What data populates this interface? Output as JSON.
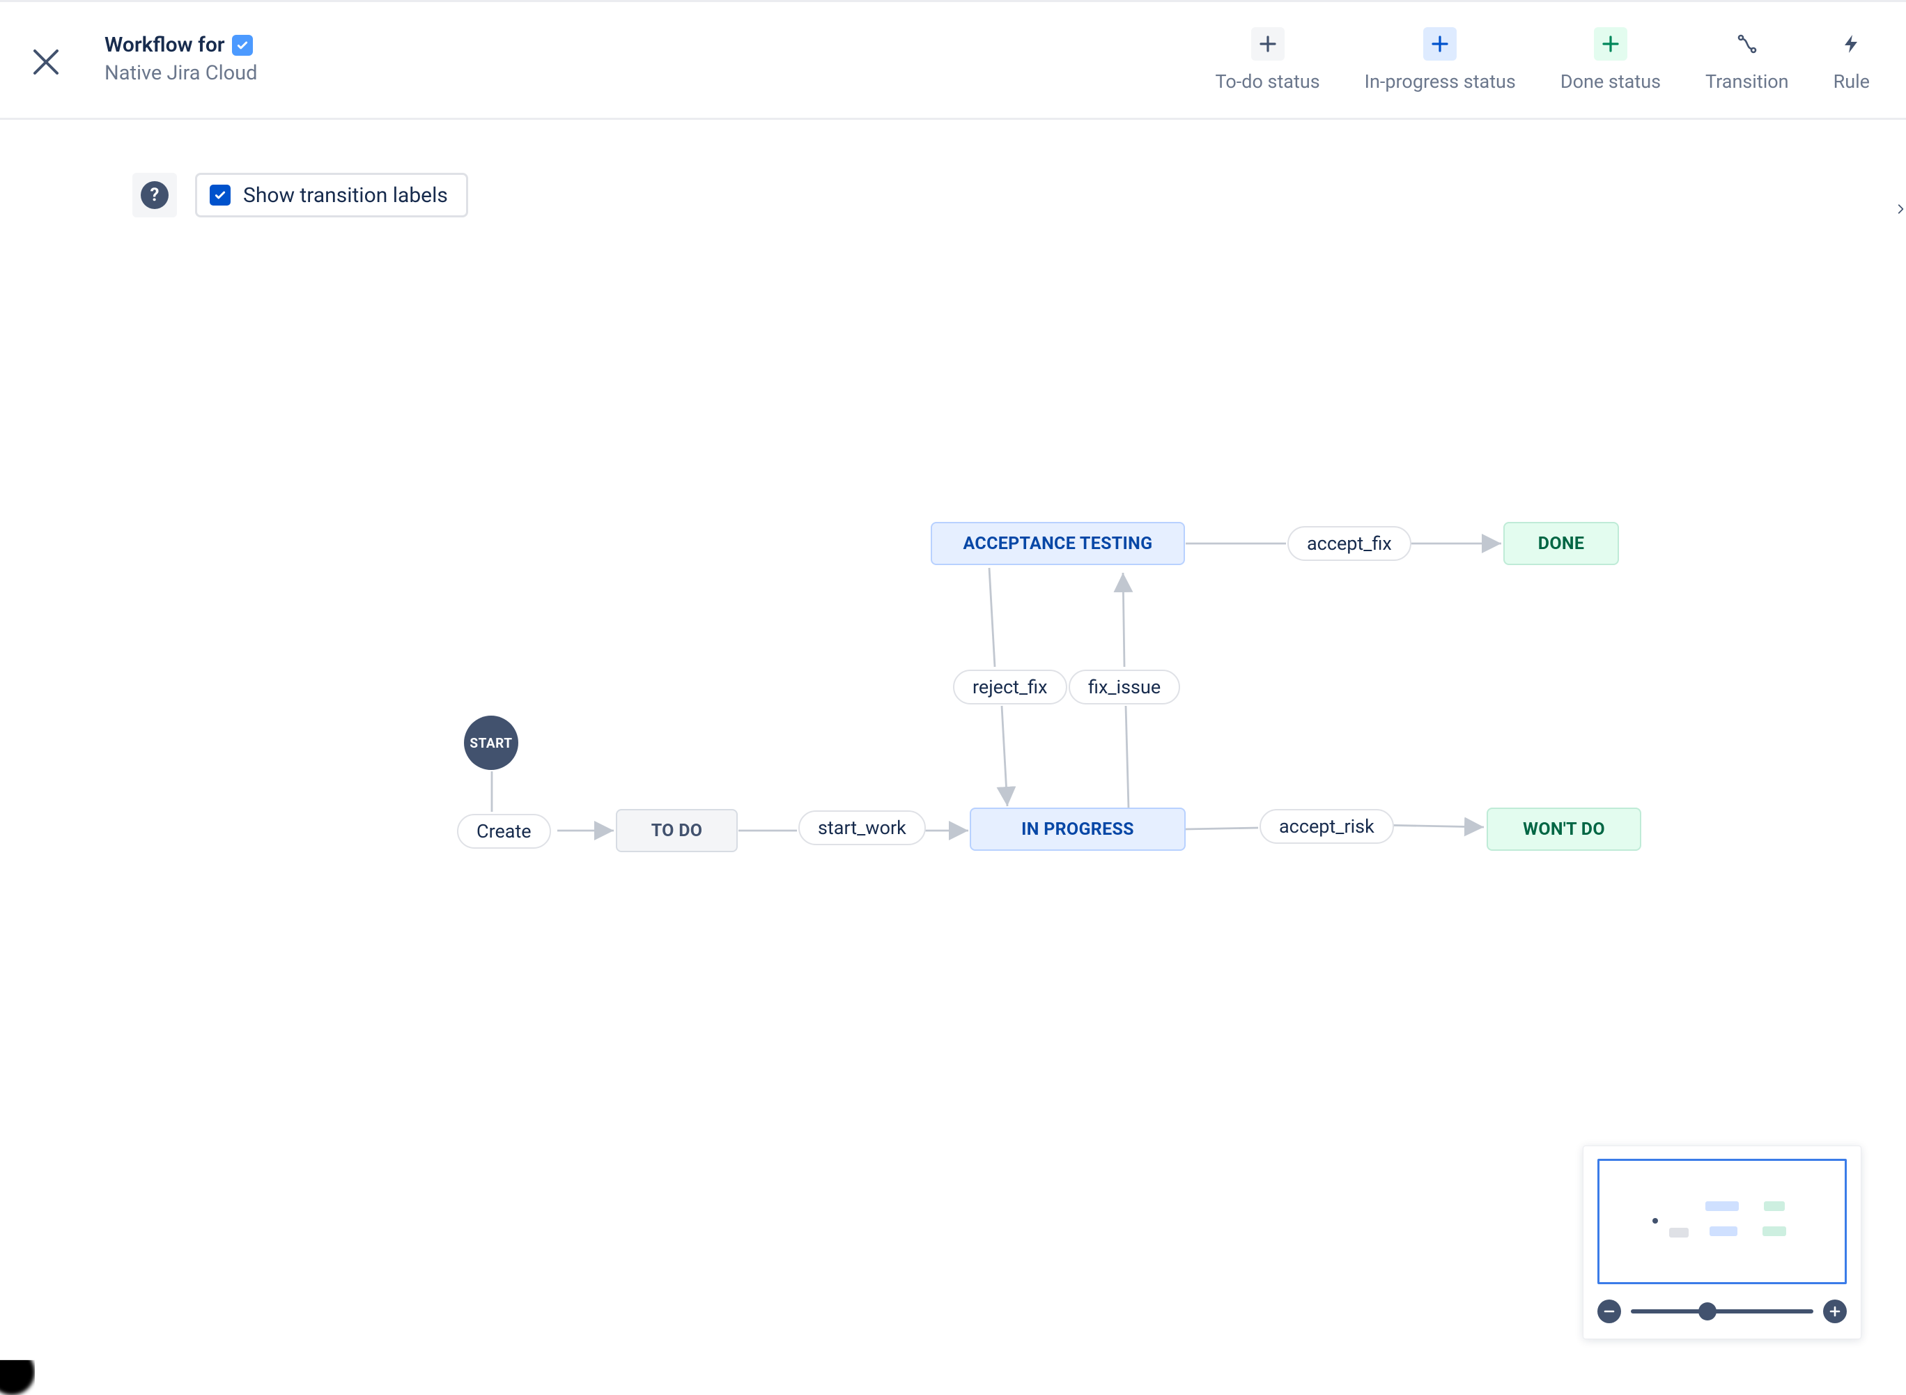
{
  "header": {
    "title": "Workflow for",
    "badge_icon": "check-icon",
    "subtitle": "Native Jira Cloud",
    "toolbar": {
      "todo": {
        "label": "To-do status"
      },
      "inprogress": {
        "label": "In-progress status"
      },
      "done": {
        "label": "Done status"
      },
      "transition": {
        "label": "Transition"
      },
      "rule": {
        "label": "Rule"
      }
    }
  },
  "subbar": {
    "help_icon": "question-mark-icon",
    "show_labels_checked": true,
    "show_labels_text": "Show transition labels"
  },
  "workflow": {
    "start_label": "START",
    "statuses": {
      "to_do": {
        "label": "TO DO",
        "category": "to-do"
      },
      "in_progress": {
        "label": "IN PROGRESS",
        "category": "in-progress"
      },
      "acceptance": {
        "label": "ACCEPTANCE TESTING",
        "category": "in-progress"
      },
      "done": {
        "label": "DONE",
        "category": "done"
      },
      "wont_do": {
        "label": "WON'T DO",
        "category": "done"
      }
    },
    "transitions": {
      "create": {
        "label": "Create",
        "from": "START",
        "to": "to_do"
      },
      "start_work": {
        "label": "start_work",
        "from": "to_do",
        "to": "in_progress"
      },
      "fix_issue": {
        "label": "fix_issue",
        "from": "in_progress",
        "to": "acceptance"
      },
      "reject_fix": {
        "label": "reject_fix",
        "from": "acceptance",
        "to": "in_progress"
      },
      "accept_fix": {
        "label": "accept_fix",
        "from": "acceptance",
        "to": "done"
      },
      "accept_risk": {
        "label": "accept_risk",
        "from": "in_progress",
        "to": "wont_do"
      }
    }
  },
  "minimap": {
    "zoom_out_icon": "minus-icon",
    "zoom_in_icon": "plus-icon",
    "zoom_value_pct": 42
  },
  "colors": {
    "brand_blue": "#0052CC",
    "status_todo_bg": "#F4F5F7",
    "status_inprogress_bg": "#E6EFFF",
    "status_done_bg": "#E3FCEF"
  }
}
